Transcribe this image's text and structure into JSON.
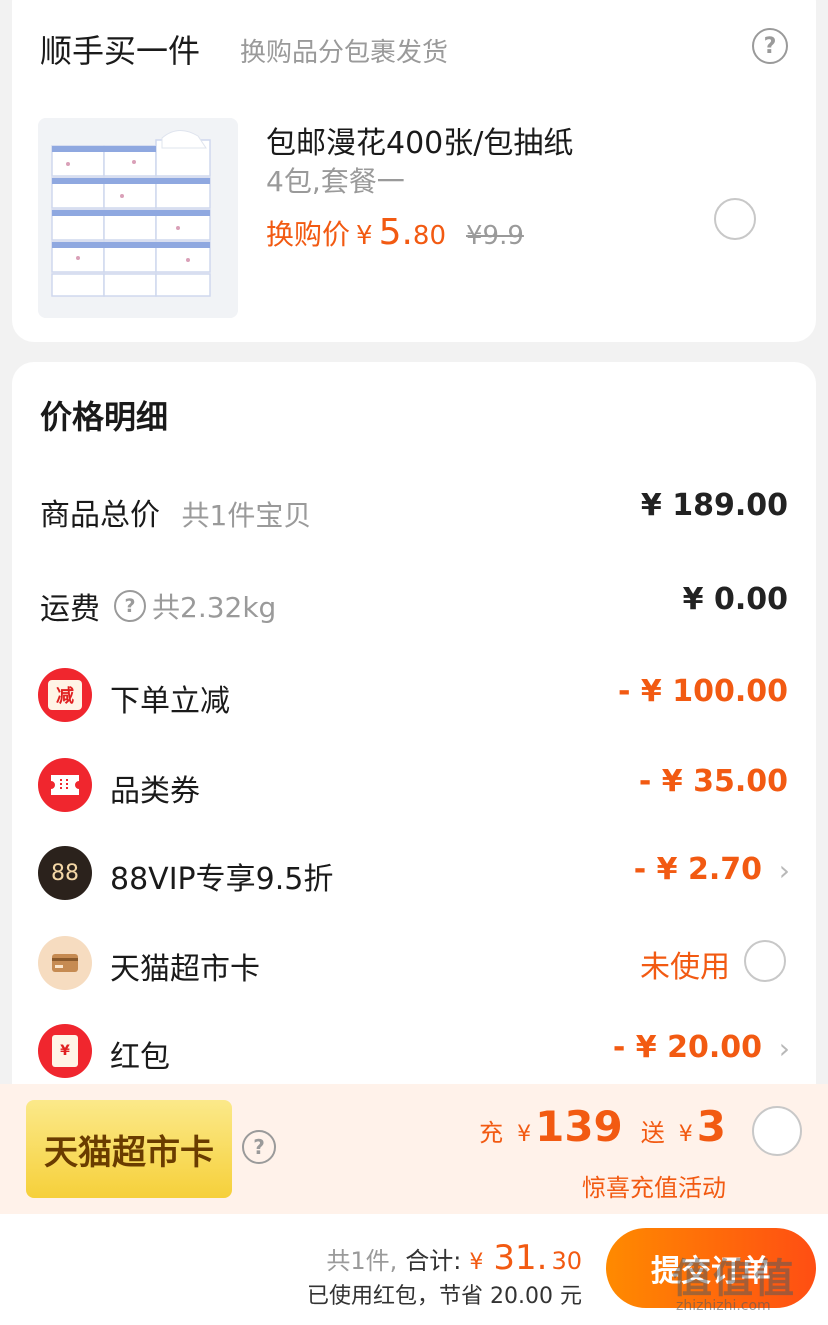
{
  "addon": {
    "title": "顺手买一件",
    "subtitle": "换购品分包裹发货",
    "product": {
      "name": "包邮漫花400张/包抽纸",
      "spec": "4包,套餐一",
      "price_label": "换购价",
      "currency": "¥",
      "price_int": "5.",
      "price_dec": "80",
      "original_price": "¥9.9"
    }
  },
  "price_detail": {
    "title": "价格明细",
    "goods_total": {
      "label": "商品总价",
      "sub": "共1件宝贝",
      "value": "¥ 189.00"
    },
    "shipping": {
      "label": "运费",
      "sub": "共2.32kg",
      "value": "¥ 0.00"
    },
    "discounts": [
      {
        "icon": "minus-badge-icon",
        "icon_text": "减",
        "label": "下单立减",
        "value": "- ¥ 100.00"
      },
      {
        "icon": "ticket-icon",
        "label": "品类券",
        "value": "- ¥ 35.00"
      },
      {
        "icon": "88vip-icon",
        "icon_text": "88",
        "label": "88VIP专享9.5折",
        "value": "- ¥ 2.70"
      },
      {
        "icon": "card-icon",
        "label": "天猫超市卡",
        "value": "未使用"
      },
      {
        "icon": "red-envelope-icon",
        "icon_text": "¥",
        "label": "红包",
        "value": "- ¥ 20.00"
      }
    ]
  },
  "promo": {
    "badge": "天猫超市卡",
    "charge_label": "充",
    "charge_currency": "¥",
    "charge_amount": "139",
    "gift_label": "送",
    "gift_currency": "¥",
    "gift_amount": "3",
    "note": "惊喜充值活动"
  },
  "bottom": {
    "count": "共1件,",
    "total_label": "合计:",
    "currency": "¥",
    "total_int": "31.",
    "total_dec": "30",
    "saved": "已使用红包，节省 20.00 元",
    "submit": "提交订单"
  },
  "watermark": {
    "text": "值值值",
    "url": "zhizhizhi.com"
  },
  "colors": {
    "accent": "#f25a12",
    "background": "#f2f2f2",
    "promo_bg": "#fff2ea"
  }
}
